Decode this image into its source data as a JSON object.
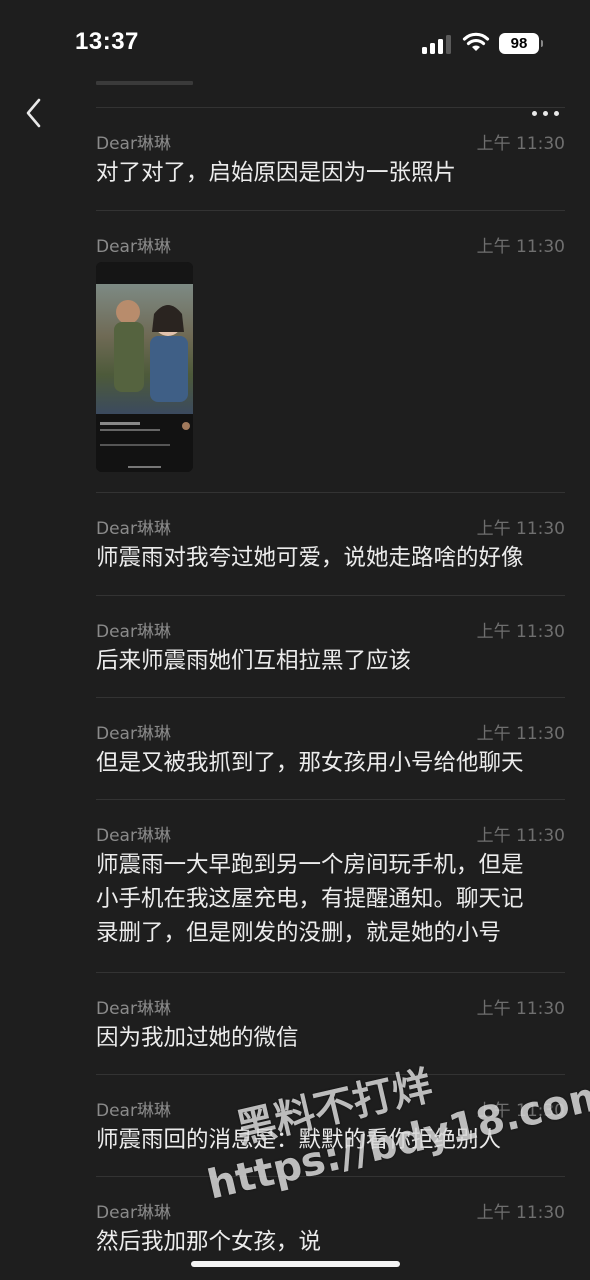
{
  "status_bar": {
    "time": "13:37",
    "battery": "98",
    "signal_icon": "cellular-signal-icon",
    "wifi_icon": "wifi-icon"
  },
  "nav": {
    "back_icon": "chevron-left-icon",
    "more_icon": "ellipsis-icon"
  },
  "messages": [
    {
      "sender": "Dear琳琳",
      "time": "上午 11:30",
      "lines": [
        "对了对了，启始原因是因为一张照片"
      ]
    },
    {
      "sender": "Dear琳琳",
      "time": "上午 11:30",
      "lines": [],
      "image": "photo-thumbnail"
    },
    {
      "sender": "Dear琳琳",
      "time": "上午 11:30",
      "lines": [
        "师震雨对我夸过她可爱，说她走路啥的好像"
      ]
    },
    {
      "sender": "Dear琳琳",
      "time": "上午 11:30",
      "lines": [
        "后来师震雨她们互相拉黑了应该"
      ]
    },
    {
      "sender": "Dear琳琳",
      "time": "上午 11:30",
      "lines": [
        "但是又被我抓到了，那女孩用小号给他聊天"
      ]
    },
    {
      "sender": "Dear琳琳",
      "time": "上午 11:30",
      "lines": [
        "师震雨一大早跑到另一个房间玩手机，但是",
        "小手机在我这屋充电，有提醒通知。聊天记",
        "录删了，但是刚发的没删，就是她的小号"
      ]
    },
    {
      "sender": "Dear琳琳",
      "time": "上午 11:30",
      "lines": [
        "因为我加过她的微信"
      ]
    },
    {
      "sender": "Dear琳琳",
      "time": "上午 11:30",
      "lines": [
        "师震雨回的消息是：默默的看你拒绝别人"
      ]
    },
    {
      "sender": "Dear琳琳",
      "time": "上午 11:30",
      "lines": [
        "然后我加那个女孩，说"
      ]
    }
  ],
  "watermark": {
    "line1": "黑料不打烊",
    "line2": "https://bdy18.com"
  }
}
